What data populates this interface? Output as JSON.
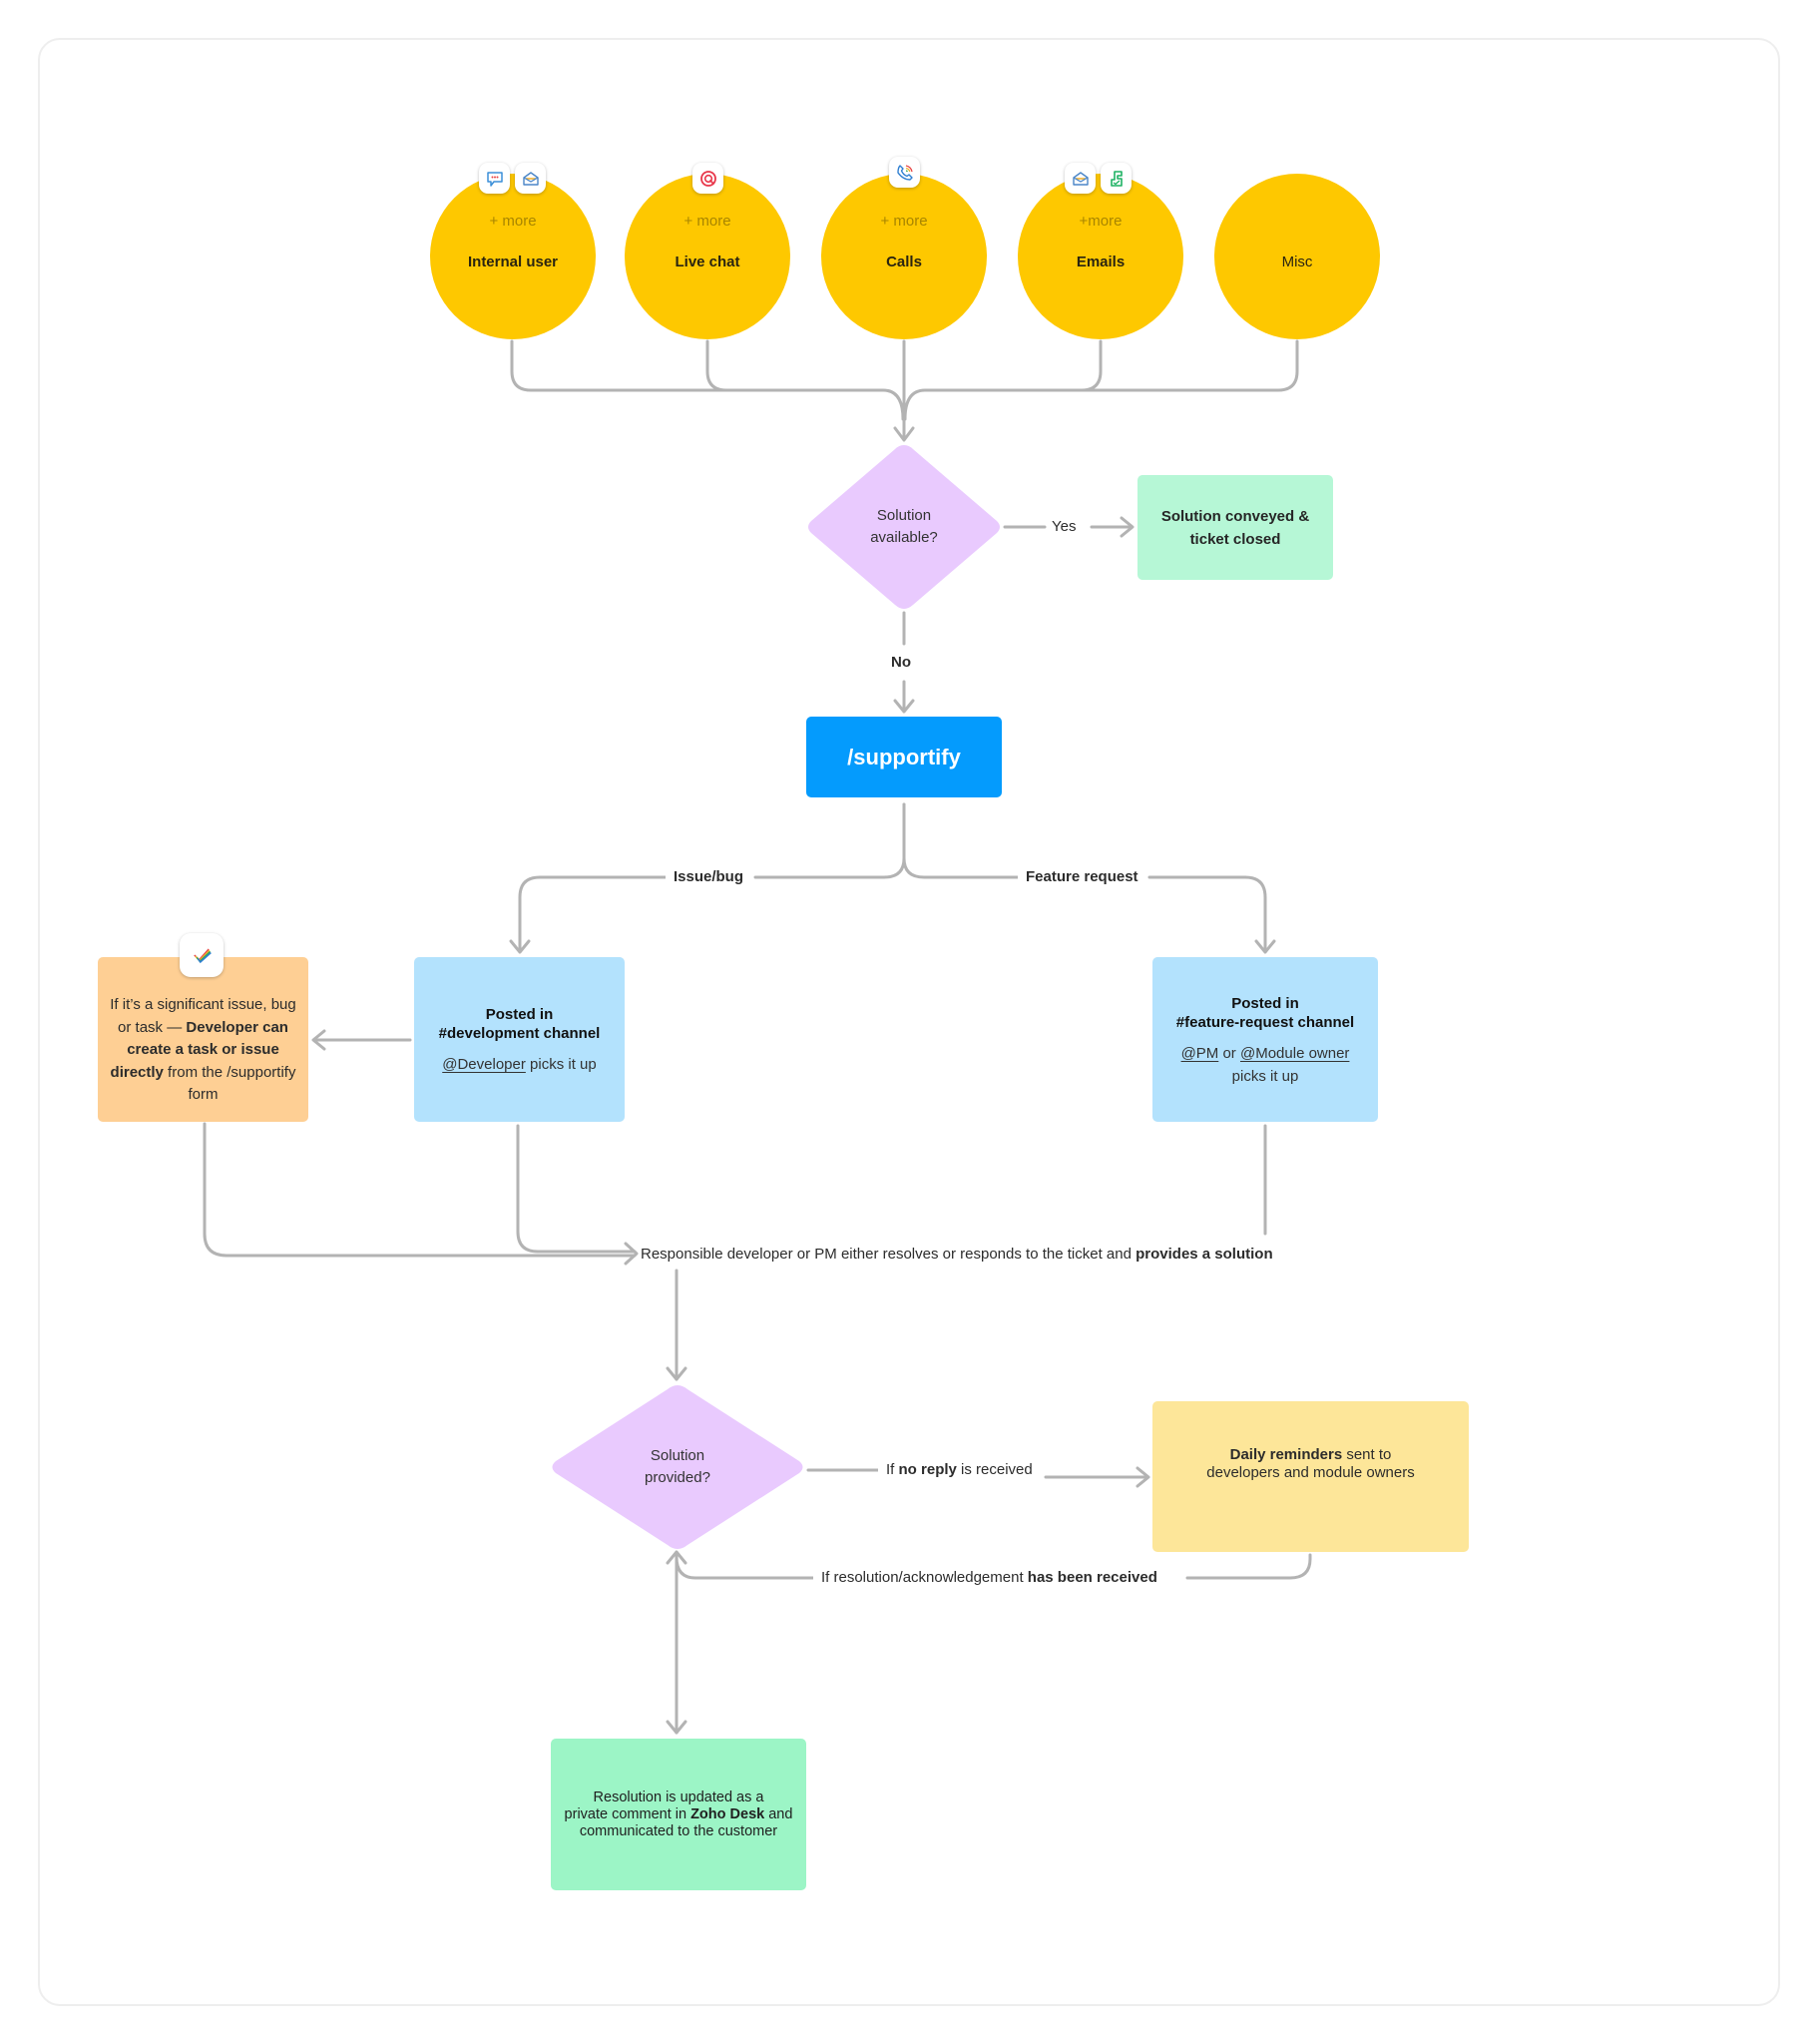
{
  "sources": [
    {
      "name": "Internal user",
      "more": "+ more",
      "icons": [
        "cliq-chat-icon",
        "mail-open-icon"
      ]
    },
    {
      "name": "Live chat",
      "more": "+ more",
      "icons": [
        "salesiq-chat-icon"
      ]
    },
    {
      "name": "Calls",
      "more": "+ more",
      "icons": [
        "phone-call-icon"
      ]
    },
    {
      "name": "Emails",
      "more": "+more",
      "icons": [
        "mail-open-icon",
        "desk-ticket-icon"
      ]
    },
    {
      "name": "Misc",
      "more": "",
      "icons": []
    }
  ],
  "decision1": {
    "line1": "Solution",
    "line2": "available?"
  },
  "yes_label": "Yes",
  "no_label": "No",
  "closed_box": {
    "line1": "Solution conveyed &",
    "line2": "ticket closed"
  },
  "supportify": {
    "label": "/supportify"
  },
  "branch_issue": "Issue/bug",
  "branch_feature": "Feature request",
  "task_box": {
    "pre": "If it’s a significant issue, bug or task — ",
    "bold": "Developer can create a task or issue directly",
    "post": " from the /supportify form",
    "icon": "projects-task-icon"
  },
  "dev_box": {
    "title1": "Posted in",
    "title2": "#development channel",
    "mention": "@Developer",
    "rest": " picks it up"
  },
  "feature_box": {
    "title1": "Posted in",
    "title2": "#feature-request channel",
    "mention1": "@PM",
    "or": " or ",
    "mention2": "@Module owner",
    "rest": "picks it up"
  },
  "responsible": {
    "text": "Responsible developer or PM either resolves or responds to the ticket and ",
    "bold": "provides a solution"
  },
  "decision2": {
    "line1": "Solution",
    "line2": "provided?"
  },
  "no_reply": {
    "pre": "If ",
    "bold": "no reply",
    "post": " is received"
  },
  "reminder_box": {
    "bold": "Daily reminders",
    "rest": " sent to",
    "line2": "developers and module owners"
  },
  "received": {
    "pre": "If resolution/acknowledgement ",
    "bold": "has been received"
  },
  "resolution_box": {
    "line1": "Resolution is updated as a",
    "pre2": "private comment in ",
    "bold": "Zoho Desk",
    "post2": " and",
    "line3": "communicated to the customer"
  },
  "colors": {
    "source_circle": "#fec800",
    "decision": "#e9cafe",
    "closed_box": "#b6f7d6",
    "supportify": "#049bfd",
    "channel_box": "#b3e2fd",
    "task_box": "#fecf94",
    "reminder_box": "#fde699",
    "resolution_box": "#9cf5c6",
    "connector": "#b3b3b3"
  }
}
